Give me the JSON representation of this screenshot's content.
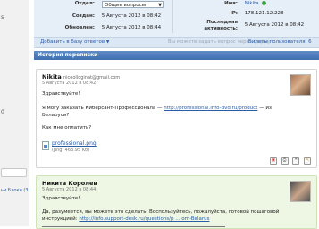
{
  "sidebar": {
    "glyph_top": "s",
    "glyph_mid": "0",
    "link_label": "ьи Блоки (3)"
  },
  "ticket": {
    "department_label": "Отдел:",
    "department_value": "Общие вопросы",
    "created_label": "Создан:",
    "created_value": "5 Августа 2012 в 08:42",
    "updated_label": "Обновлен:",
    "updated_value": "5 Августа 2012 в 08:44",
    "name_label": "Имя:",
    "name_value": "Nikita",
    "ip_label": "IP:",
    "ip_value": "178.121.12.228",
    "last_activity_label_1": "Последняя",
    "last_activity_label_2": "активность:",
    "last_activity_value": "5 Августа 2012 в 08:42"
  },
  "toolbar": {
    "add_kb": "Добавить в базу ответов",
    "add_kb_arrow": "▼",
    "edit_link": "Вы можете задать вопрос через форму",
    "recipients": "Билеты пользователя: 6"
  },
  "history": {
    "title": "История переписки"
  },
  "messages": [
    {
      "author": "Nikita",
      "email": "nicoolloginat@gmail.com",
      "date": "5 Августа 2012 в 08:42",
      "greeting": "Здравствуйте!",
      "line1_before": "Я могу заказать Киберсант-Профессионала —",
      "line1_link": "http://professional.info-dvd.ru/product",
      "line1_after": "— из",
      "line2": "Беларуси?",
      "line3": "Как мне оплатить?",
      "attachment_name": "professional.png",
      "attachment_size": "(png, 463.95 Kб)",
      "action_icons": [
        "pdf-icon",
        "print-icon",
        "quote-icon",
        "edit-icon"
      ]
    },
    {
      "author": "Никита Королев",
      "date": "5 Августа 2012 в 08:44",
      "greeting": "Здравствуйте!",
      "line1": "Да, разумеется, вы можете это сделать. Воспользуйтесь, пожалуйста, готовой пошаговой",
      "line2_before": "инструкцией:",
      "line2_link": "http://info.support-desk.ru/questions/p ... om-Belarus"
    }
  ]
}
